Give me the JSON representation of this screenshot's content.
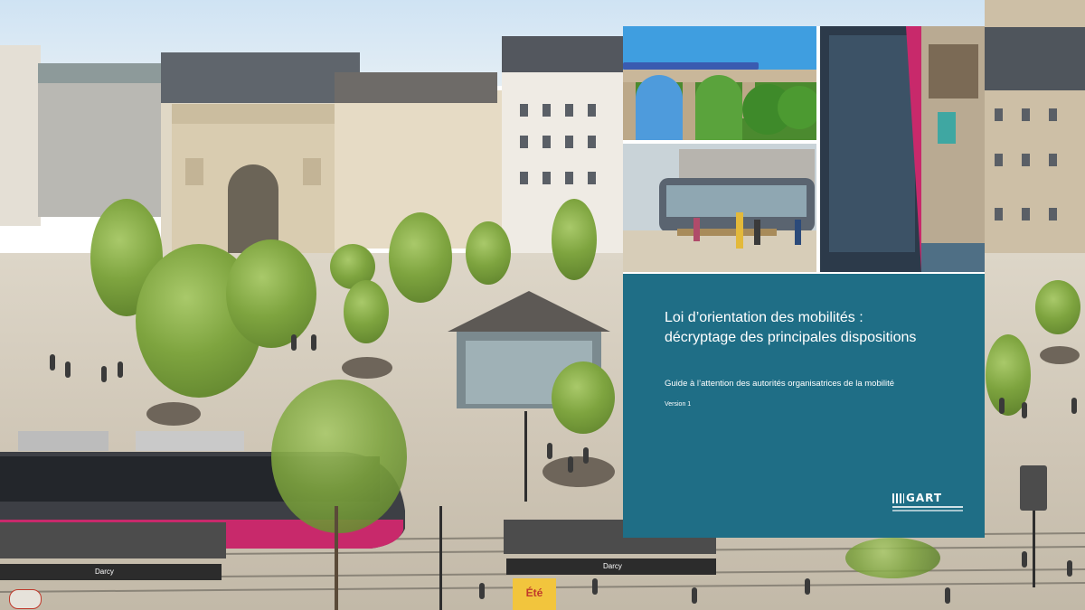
{
  "cover": {
    "title_line1": "Loi d’orientation des mobilités :",
    "title_line2": "décryptage des principales dispositions",
    "subtitle": "Guide à l’attention des autorités organisatrices de la mobilité",
    "version": "Version 1",
    "logo_text": "GART",
    "panel_color": "#1f6e86"
  },
  "scene": {
    "shelter_sign_left": "Darcy",
    "shelter_sign_right": "Darcy",
    "poster_text": "Été"
  },
  "colors": {
    "tram_accent": "#c8296b",
    "tree_green": "#7ea43f",
    "stone": "#d9ccb0"
  }
}
